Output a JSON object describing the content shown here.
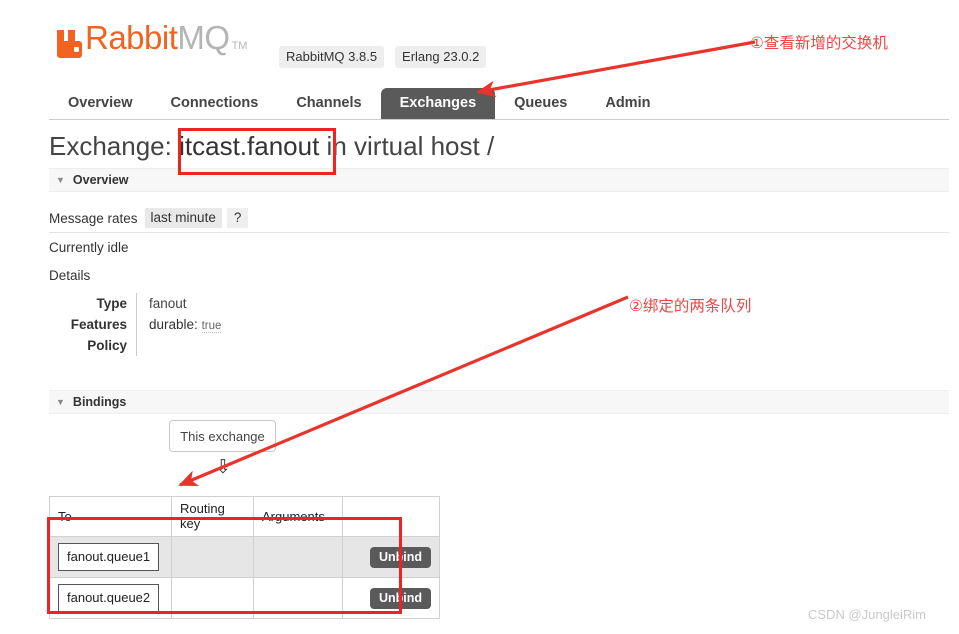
{
  "header": {
    "logo_rabbit": "Rabbit",
    "logo_mq": "MQ",
    "logo_tm": "TM",
    "version_rabbitmq": "RabbitMQ 3.8.5",
    "version_erlang": "Erlang 23.0.2"
  },
  "nav": {
    "tabs": [
      {
        "label": "Overview",
        "active": false
      },
      {
        "label": "Connections",
        "active": false
      },
      {
        "label": "Channels",
        "active": false
      },
      {
        "label": "Exchanges",
        "active": true
      },
      {
        "label": "Queues",
        "active": false
      },
      {
        "label": "Admin",
        "active": false
      }
    ]
  },
  "page": {
    "title_prefix": "Exchange:",
    "exchange_name": "itcast.fanout",
    "title_suffix": "in virtual host /"
  },
  "overview": {
    "section_label": "Overview",
    "caret": "▼",
    "message_rates_label": "Message rates",
    "rate_period": "last minute",
    "help": "?",
    "idle_text": "Currently idle",
    "details_label": "Details",
    "details": [
      {
        "key": "Type",
        "value": "fanout"
      },
      {
        "key": "Features",
        "feature_key": "durable:",
        "feature_value": "true"
      },
      {
        "key": "Policy",
        "value": ""
      }
    ]
  },
  "bindings": {
    "section_label": "Bindings",
    "caret": "▼",
    "this_exchange_label": "This exchange",
    "down_arrow": "⇩",
    "columns": [
      "To",
      "Routing key",
      "Arguments",
      ""
    ],
    "rows": [
      {
        "to": "fanout.queue1",
        "routing_key": "",
        "arguments": "",
        "action": "Unbind"
      },
      {
        "to": "fanout.queue2",
        "routing_key": "",
        "arguments": "",
        "action": "Unbind"
      }
    ]
  },
  "annotations": {
    "note_1": "①查看新增的交换机",
    "note_2": "②绑定的两条队列",
    "highlight_color": "#F02323",
    "arrow_color": "#E8342C"
  },
  "watermark": "CSDN @JungleiRim"
}
